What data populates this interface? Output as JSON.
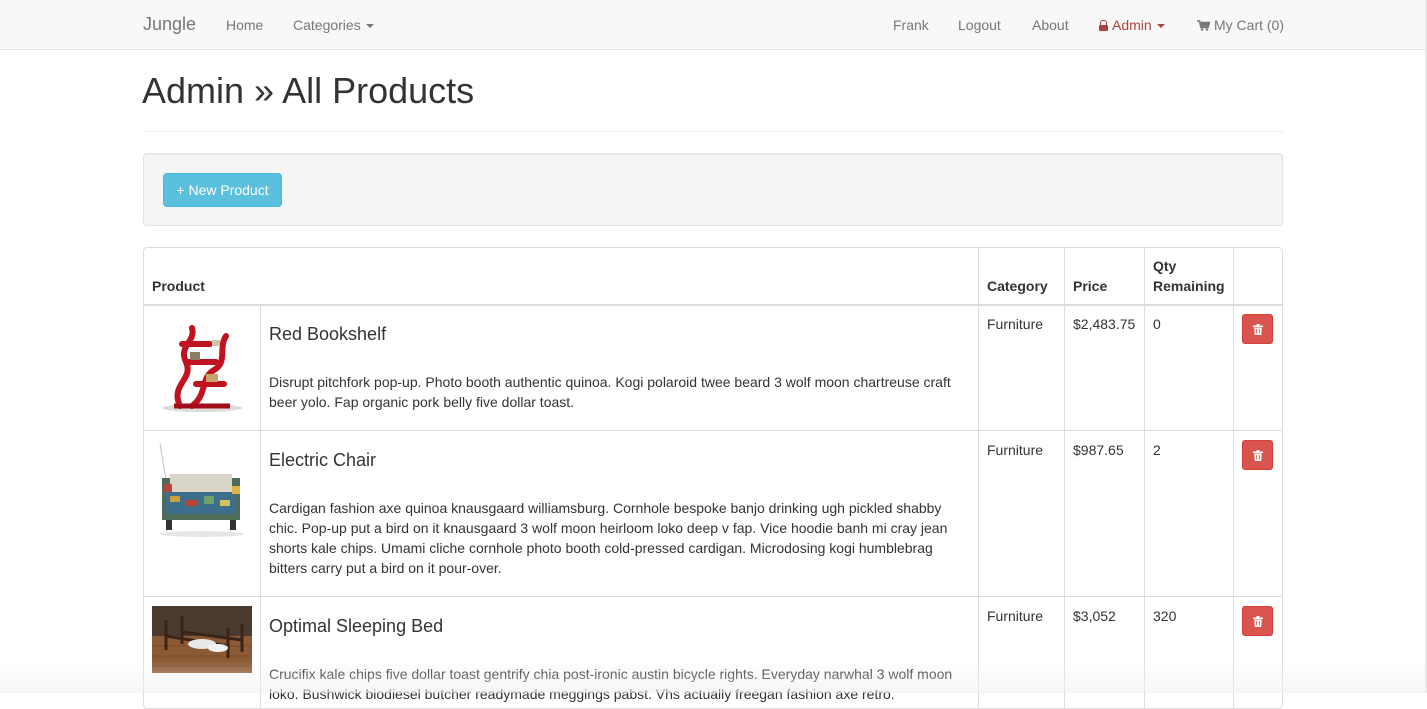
{
  "navbar": {
    "brand": "Jungle",
    "left_links": {
      "home": "Home",
      "categories": "Categories"
    },
    "right_links": {
      "user": "Frank",
      "logout": "Logout",
      "about": "About",
      "admin": "Admin",
      "cart": "My Cart (0)"
    },
    "admin_color": "#a94442"
  },
  "header": {
    "title": "Admin » All Products"
  },
  "actions": {
    "new_product": "+ New Product"
  },
  "table": {
    "headers": {
      "product": "Product",
      "category": "Category",
      "price": "Price",
      "qty": "Qty Remaining"
    },
    "rows": [
      {
        "name": "Red Bookshelf",
        "description": "Disrupt pitchfork pop-up. Photo booth authentic quinoa. Kogi polaroid twee beard 3 wolf moon chartreuse craft beer yolo. Fap organic pork belly five dollar toast.",
        "category": "Furniture",
        "price": "$2,483.75",
        "qty": "0",
        "image": "red-bookshelf-photo"
      },
      {
        "name": "Electric Chair",
        "description": "Cardigan fashion axe quinoa knausgaard williamsburg. Cornhole bespoke banjo drinking ugh pickled shabby chic. Pop-up put a bird on it knausgaard 3 wolf moon heirloom loko deep v fap. Vice hoodie banh mi cray jean shorts kale chips. Umami cliche cornhole photo booth cold-pressed cardigan. Microdosing kogi humblebrag bitters carry put a bird on it pour-over.",
        "category": "Furniture",
        "price": "$987.65",
        "qty": "2",
        "image": "electric-chair-photo"
      },
      {
        "name": "Optimal Sleeping Bed",
        "description": "Crucifix kale chips five dollar toast gentrify chia post-ironic austin bicycle rights. Everyday narwhal 3 wolf moon loko. Bushwick biodiesel butcher readymade meggings pabst. Vhs actually freegan fashion axe retro.",
        "category": "Furniture",
        "price": "$3,052",
        "qty": "320",
        "image": "sleeping-bed-photo"
      }
    ]
  },
  "colors": {
    "info_button": "#5bc0de",
    "danger_button": "#d9534f"
  },
  "icons": {
    "admin": "lock-icon",
    "cart": "cart-icon",
    "delete": "trash-icon"
  }
}
